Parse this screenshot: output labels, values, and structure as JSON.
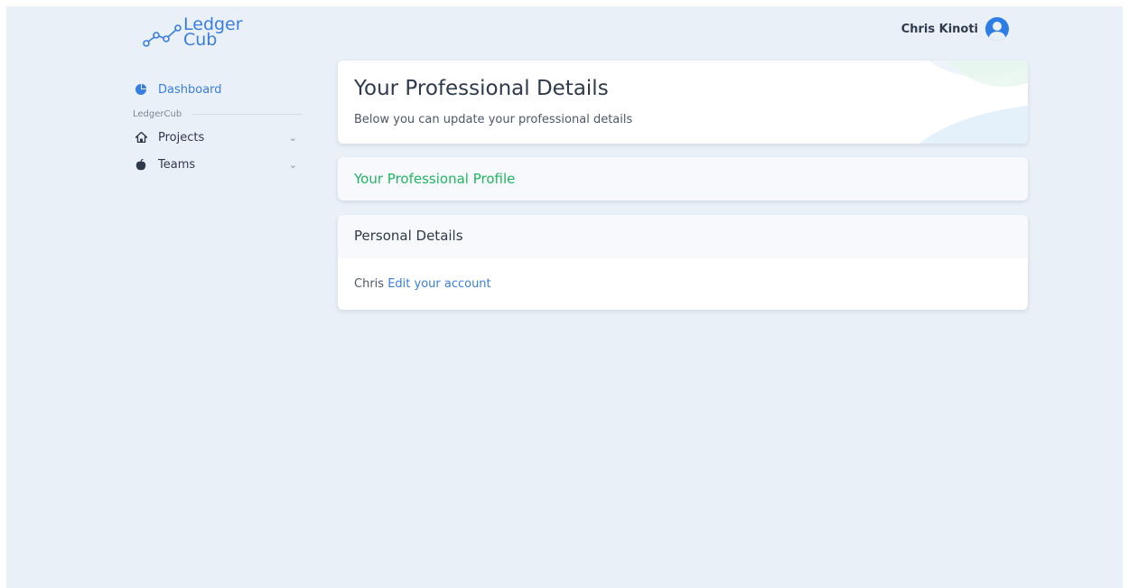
{
  "brand": {
    "line1": "Ledger",
    "line2": "Cub",
    "color": "#3a7de0"
  },
  "header": {
    "user_name": "Chris Kinoti",
    "avatar_icon": "user-avatar-icon"
  },
  "sidebar": {
    "dashboard": {
      "label": "Dashboard",
      "icon": "pie-chart-icon"
    },
    "section_label": "LedgerCub",
    "items": [
      {
        "label": "Projects",
        "icon": "home-icon"
      },
      {
        "label": "Teams",
        "icon": "apple-icon"
      }
    ]
  },
  "hero": {
    "title": "Your Professional Details",
    "subtitle": "Below you can update your professional details"
  },
  "profile_card": {
    "title": "Your Professional Profile",
    "color": "#22b55f"
  },
  "personal_card": {
    "title": "Personal Details",
    "name": "Chris",
    "edit_link": "Edit your account"
  }
}
